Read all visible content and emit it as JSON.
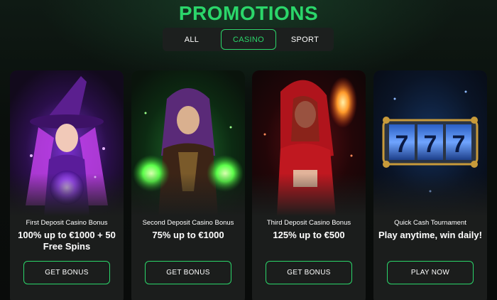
{
  "page": {
    "title": "PROMOTIONS"
  },
  "tabs": [
    {
      "label": "ALL",
      "active": false
    },
    {
      "label": "CASINO",
      "active": true
    },
    {
      "label": "SPORT",
      "active": false
    }
  ],
  "cards": [
    {
      "name": "First Deposit Casino Bonus",
      "offer": "100% up to €1000 + 50 Free Spins",
      "button": "GET BONUS",
      "art": "purple-witch-illustration"
    },
    {
      "name": "Second Deposit Casino Bonus",
      "offer": "75% up to €1000",
      "button": "GET BONUS",
      "art": "green-sorceress-illustration"
    },
    {
      "name": "Third Deposit Casino Bonus",
      "offer": "125% up to €500",
      "button": "GET BONUS",
      "art": "red-hooded-woman-illustration"
    },
    {
      "name": "Quick Cash Tournament",
      "offer": "Play anytime, win daily!",
      "button": "PLAY NOW",
      "art": "slot-machine-777-illustration"
    }
  ],
  "slot_symbols": [
    "7",
    "7",
    "7"
  ],
  "colors": {
    "accent": "#2bd66a",
    "card_bg": "#1b1d1c",
    "page_bg": "#0a0e0c"
  }
}
